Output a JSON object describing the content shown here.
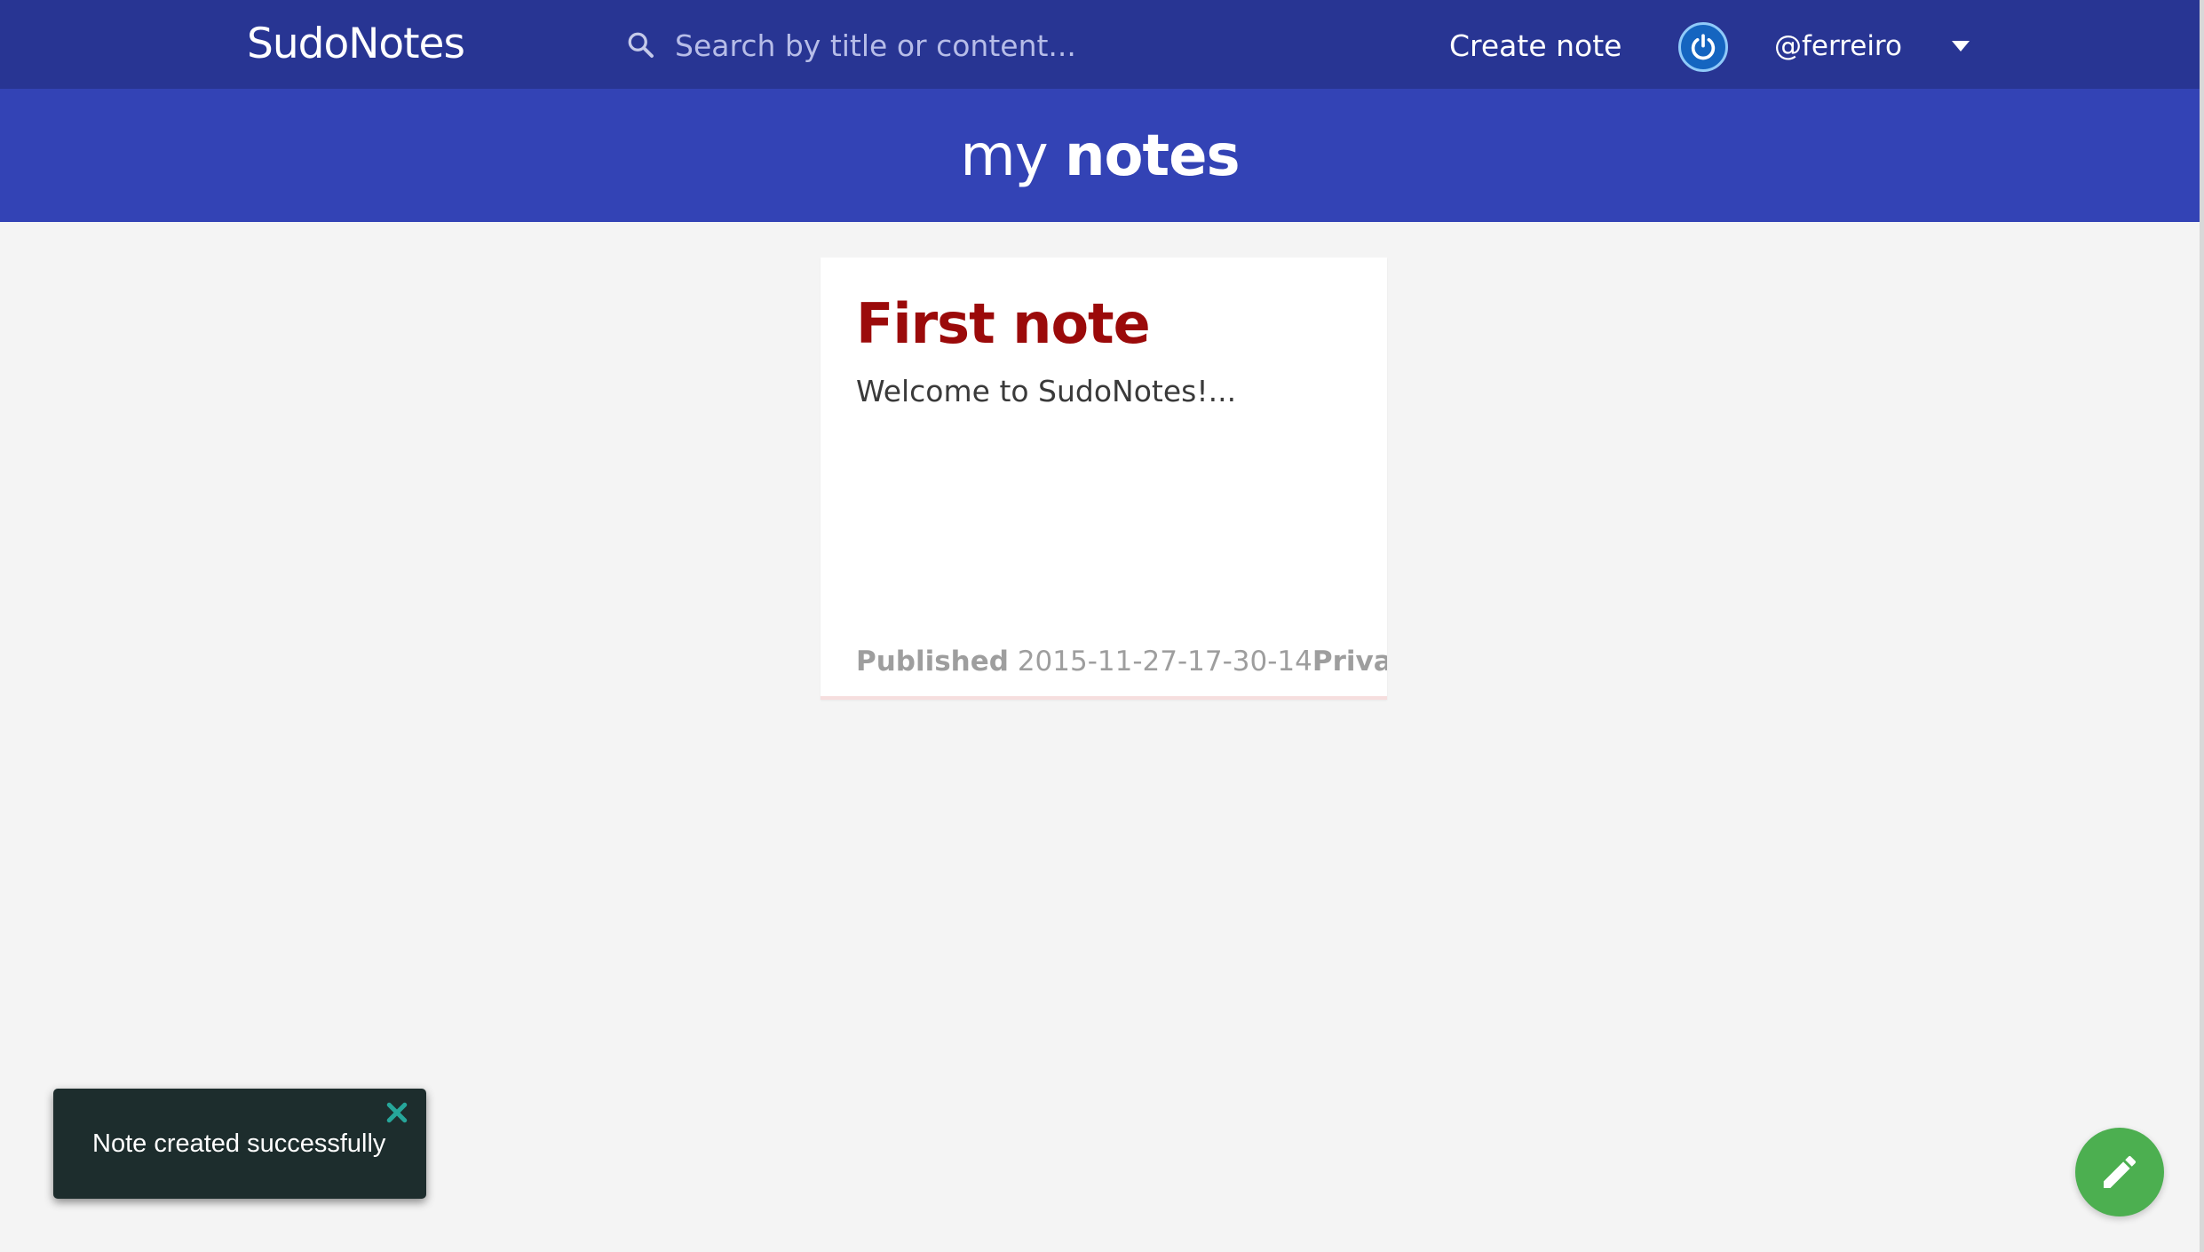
{
  "navbar": {
    "brand": "SudoNotes",
    "search": {
      "placeholder": "Search by title or content...",
      "value": "",
      "icon": "search-icon"
    },
    "create_note_label": "Create note",
    "avatar_icon": "power-icon",
    "username": "@ferreiro",
    "menu_icon": "caret-down-icon",
    "background_color": "#283593"
  },
  "header": {
    "title_light": "my",
    "title_bold": "notes",
    "background_color": "#3343b5"
  },
  "notes": [
    {
      "title": "First note",
      "excerpt": "Welcome to SudoNotes!...",
      "published_label": "Published",
      "published_date": "2015-11-27-17-30-14",
      "visibility_label": "Private-",
      "title_color": "#9b0a0a"
    }
  ],
  "toast": {
    "message": "Note created successfully",
    "close_icon": "close-icon"
  },
  "fab": {
    "icon": "pencil-icon",
    "color": "#4caf50"
  }
}
